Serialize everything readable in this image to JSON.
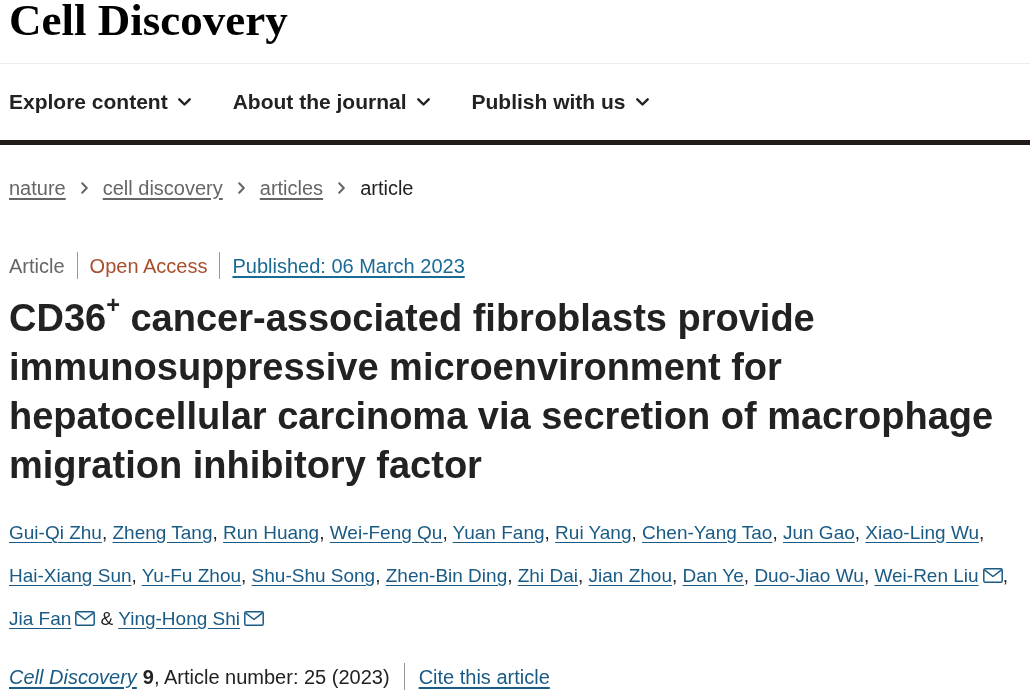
{
  "masthead": {
    "title": "Cell Discovery"
  },
  "nav": [
    {
      "label": "Explore content"
    },
    {
      "label": "About the journal"
    },
    {
      "label": "Publish with us"
    }
  ],
  "breadcrumbs": [
    {
      "label": "nature",
      "kind": "link"
    },
    {
      "label": "cell discovery",
      "kind": "link"
    },
    {
      "label": "articles",
      "kind": "link"
    },
    {
      "label": "article",
      "kind": "current"
    }
  ],
  "article": {
    "type": "Article",
    "access": "Open Access",
    "published": "Published: 06 March 2023",
    "title": "CD36$^{+}$ cancer-associated fibroblasts provide immunosuppressive microenvironment for hepatocellular carcinoma via secretion of macrophage migration inhibitory factor",
    "authors": {
      "list_separator": ",",
      "final_separator": "&",
      "people": [
        {
          "name": "Gui-Qi Zhu",
          "corresponding": false
        },
        {
          "name": "Zheng Tang",
          "corresponding": false
        },
        {
          "name": "Run Huang",
          "corresponding": false
        },
        {
          "name": "Wei-Feng Qu",
          "corresponding": false
        },
        {
          "name": "Yuan Fang",
          "corresponding": false
        },
        {
          "name": "Rui Yang",
          "corresponding": false
        },
        {
          "name": "Chen-Yang Tao",
          "corresponding": false
        },
        {
          "name": "Jun Gao",
          "corresponding": false
        },
        {
          "name": "Xiao-Ling Wu",
          "corresponding": false
        },
        {
          "name": "Hai-Xiang Sun",
          "corresponding": false
        },
        {
          "name": "Yu-Fu Zhou",
          "corresponding": false
        },
        {
          "name": "Shu-Shu Song",
          "corresponding": false
        },
        {
          "name": "Zhen-Bin Ding",
          "corresponding": false
        },
        {
          "name": "Zhi Dai",
          "corresponding": false
        },
        {
          "name": "Jian Zhou",
          "corresponding": false
        },
        {
          "name": "Dan Ye",
          "corresponding": false
        },
        {
          "name": "Duo-Jiao Wu",
          "corresponding": false
        },
        {
          "name": "Wei-Ren Liu",
          "corresponding": true
        },
        {
          "name": "Jia Fan",
          "corresponding": true
        },
        {
          "name": "Ying-Hong Shi",
          "corresponding": true
        }
      ]
    },
    "citation": {
      "journal": "Cell Discovery",
      "volume": "9",
      "details": ", Article number: 25 (2023)",
      "cite_link": "Cite this article"
    }
  }
}
